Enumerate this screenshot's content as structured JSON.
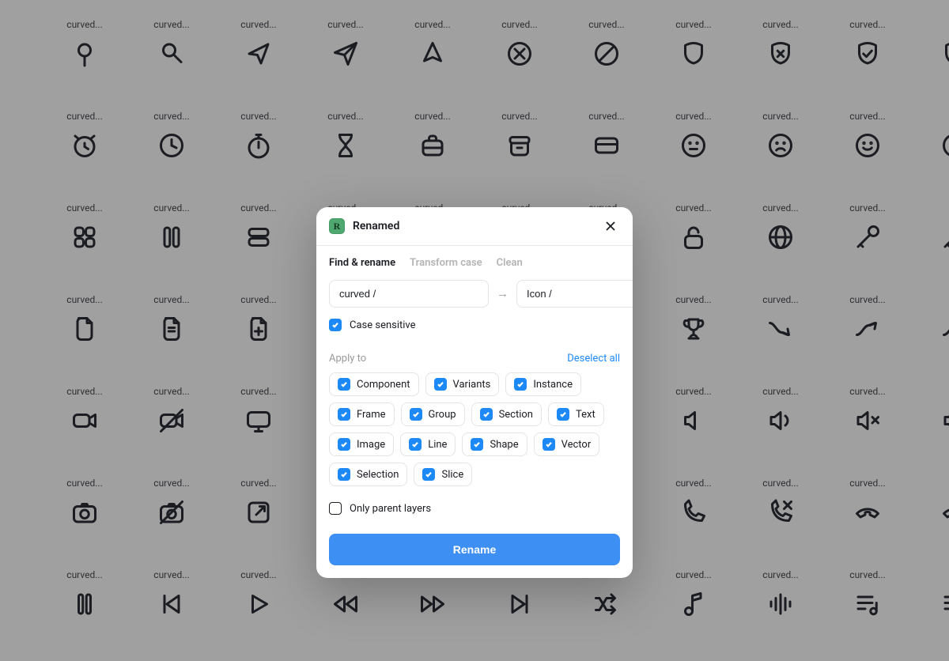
{
  "grid": {
    "label": "curved...",
    "truncated_label": "cu",
    "icons": [
      [
        "pin-round",
        "pin-tilt",
        "send",
        "paper-plane",
        "cursor",
        "circle-cross",
        "ban",
        "shield",
        "shield-cross",
        "shield-check",
        "shield-check"
      ],
      [
        "alarm",
        "clock",
        "stopwatch",
        "hourglass",
        "briefcase",
        "archive",
        "credit-card",
        "face-neutral",
        "face-sad",
        "face-smile",
        "face-smile"
      ],
      [
        "grid-apps",
        "pause",
        "list-rows",
        "",
        "",
        "",
        "",
        "lock-open",
        "globe",
        "key",
        "key"
      ],
      [
        "file-blank",
        "file-minus",
        "file-plus",
        "",
        "",
        "",
        "",
        "trophy",
        "trend-down",
        "trend-up",
        "trend-up"
      ],
      [
        "video",
        "video-off",
        "monitor",
        "",
        "",
        "",
        "",
        "volume-low",
        "volume",
        "volume-mute",
        "volume-mute"
      ],
      [
        "camera",
        "camera-off",
        "external",
        "",
        "",
        "",
        "",
        "phone",
        "phone-missed",
        "phone-end",
        "phone-end"
      ],
      [
        "pause-alt",
        "skip-back",
        "play",
        "rewind",
        "fast-forward",
        "skip-forward",
        "shuffle",
        "music-note",
        "audio-wave",
        "playlist",
        "playlist"
      ]
    ]
  },
  "modal": {
    "title": "Renamed",
    "app_badge": "R",
    "tabs": {
      "find_rename": "Find & rename",
      "transform_case": "Transform case",
      "clean": "Clean"
    },
    "find_value": "curved /",
    "replace_value": "Icon /",
    "case_sensitive_label": "Case sensitive",
    "case_sensitive_checked": true,
    "apply_to_label": "Apply to",
    "deselect_all_label": "Deselect all",
    "types": [
      {
        "key": "component",
        "label": "Component",
        "checked": true
      },
      {
        "key": "variants",
        "label": "Variants",
        "checked": true
      },
      {
        "key": "instance",
        "label": "Instance",
        "checked": true
      },
      {
        "key": "frame",
        "label": "Frame",
        "checked": true
      },
      {
        "key": "group",
        "label": "Group",
        "checked": true
      },
      {
        "key": "section",
        "label": "Section",
        "checked": true
      },
      {
        "key": "text",
        "label": "Text",
        "checked": true
      },
      {
        "key": "image",
        "label": "Image",
        "checked": true
      },
      {
        "key": "line",
        "label": "Line",
        "checked": true
      },
      {
        "key": "shape",
        "label": "Shape",
        "checked": true
      },
      {
        "key": "vector",
        "label": "Vector",
        "checked": true
      },
      {
        "key": "selection",
        "label": "Selection",
        "checked": true
      },
      {
        "key": "slice",
        "label": "Slice",
        "checked": true
      }
    ],
    "only_parent_label": "Only parent layers",
    "only_parent_checked": false,
    "rename_button": "Rename"
  }
}
